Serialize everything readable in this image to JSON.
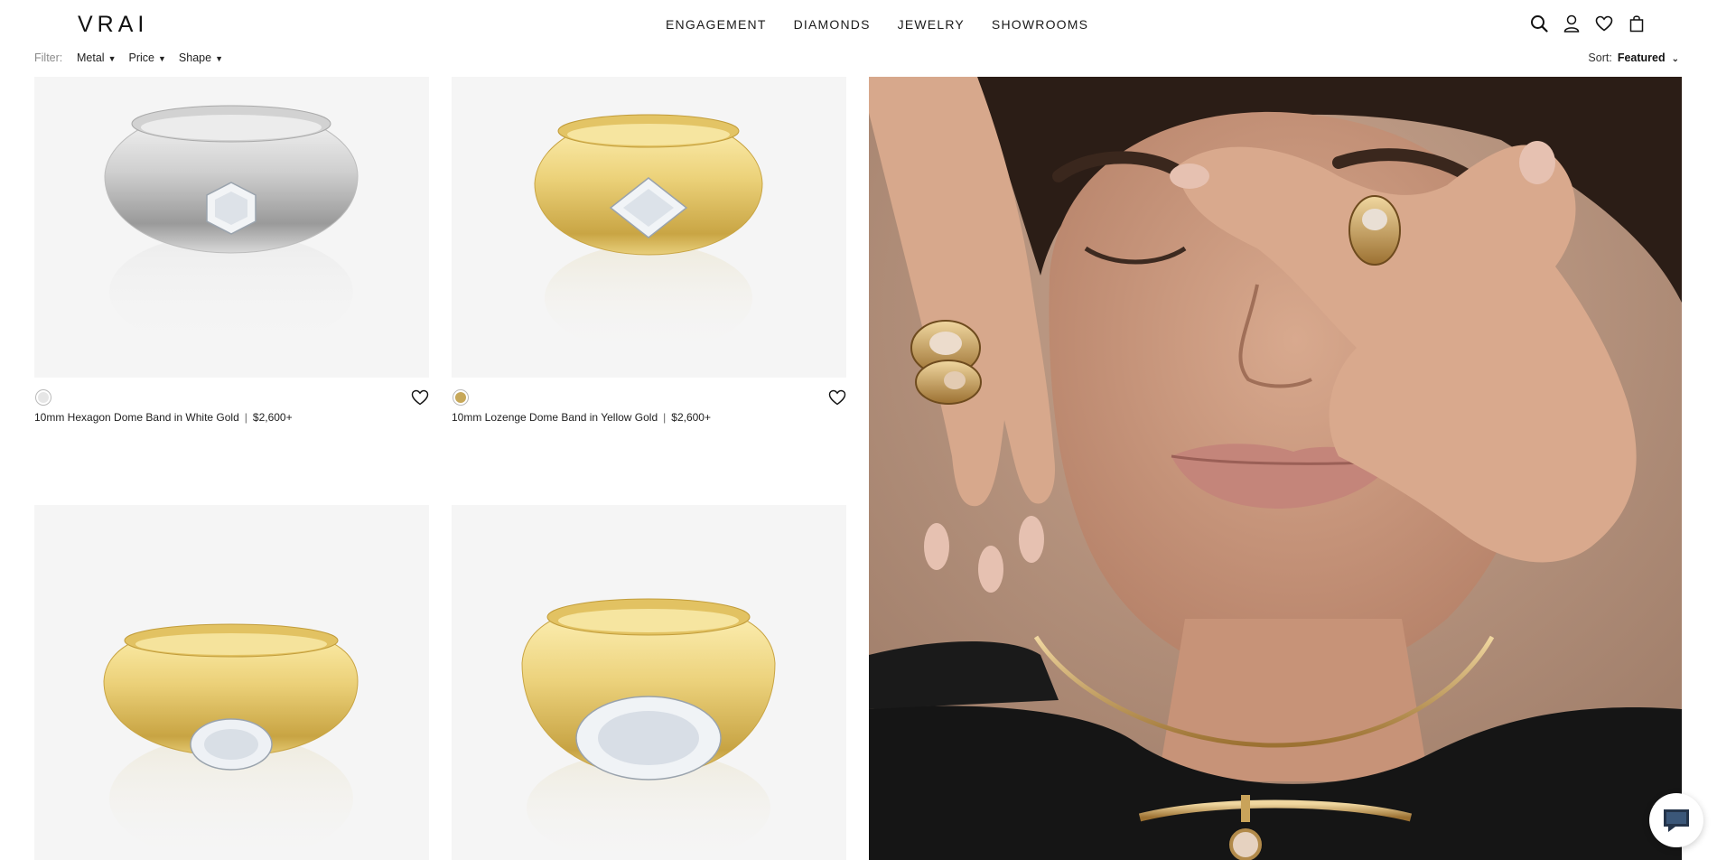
{
  "brand": {
    "logo": "VRAI"
  },
  "nav": {
    "items": [
      {
        "label": "ENGAGEMENT"
      },
      {
        "label": "DIAMONDS"
      },
      {
        "label": "JEWELRY"
      },
      {
        "label": "SHOWROOMS"
      }
    ]
  },
  "header_icons": [
    "search-icon",
    "account-icon",
    "wishlist-heart-icon",
    "shopping-bag-icon"
  ],
  "filters": {
    "label": "Filter:",
    "options": [
      {
        "label": "Metal"
      },
      {
        "label": "Price"
      },
      {
        "label": "Shape"
      }
    ]
  },
  "sort": {
    "label": "Sort:",
    "value": "Featured"
  },
  "products": [
    {
      "name": "10mm Hexagon Dome Band in White Gold",
      "price": "$2,600+",
      "metal_color": "#e6e6e6",
      "metal_ring": "#c9c9c9"
    },
    {
      "name": "10mm Lozenge Dome Band in Yellow Gold",
      "price": "$2,600+",
      "metal_color": "#c7a85a",
      "metal_ring": "#b9b9b9"
    },
    {
      "name": "",
      "price": "",
      "metal_color": "#e8cf7c"
    },
    {
      "name": "",
      "price": "",
      "metal_color": "#e8cf7c"
    }
  ],
  "colors": {
    "white_gold": "#e6e6e6",
    "yellow_gold": "#e8cf7c",
    "image_bg": "#f5f5f5",
    "campaign_bg": "#b08e7a"
  },
  "chat": {
    "icon": "chat-bubble-icon"
  }
}
